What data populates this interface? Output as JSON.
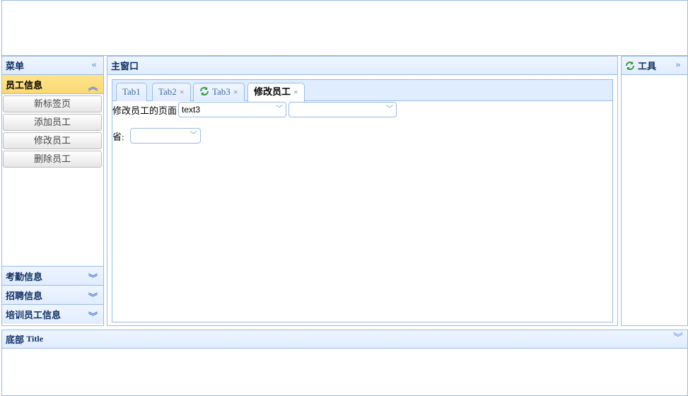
{
  "west": {
    "title": "菜单",
    "collapse_icon": "double-chevron-left-icon",
    "sections": [
      {
        "label": "员工信息",
        "items": [
          "新标签页",
          "添加员工",
          "修改员工",
          "删除员工"
        ]
      },
      {
        "label": "考勤信息"
      },
      {
        "label": "招聘信息"
      },
      {
        "label": "培训员工信息"
      }
    ]
  },
  "center": {
    "title": "主窗口",
    "tabs": [
      {
        "label": "Tab1"
      },
      {
        "label": "Tab2",
        "close": "×"
      },
      {
        "label": "Tab3",
        "close": "×"
      },
      {
        "label": "修改员工",
        "close": "×"
      }
    ],
    "content": {
      "page_label": "修改员工的页面",
      "combo1_value": "text3",
      "combo2_value": "",
      "province_label": "省:",
      "province_value": ""
    }
  },
  "east": {
    "title": "工具",
    "icon": "refresh-icon"
  },
  "south": {
    "title_cn": "底部",
    "title_en": "Title"
  },
  "colors": {
    "border": "#99bbe8",
    "header": "#e0ecff",
    "selected": "#fbd872",
    "title_text": "#0e2d5f"
  }
}
